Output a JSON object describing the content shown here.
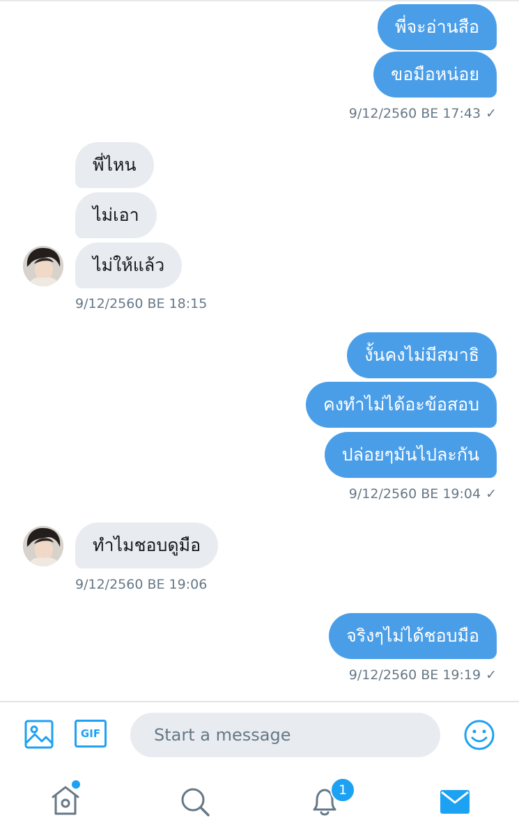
{
  "conversation": [
    {
      "type": "out",
      "text": "พี่จะอ่านสือ"
    },
    {
      "type": "out",
      "text": "ขอมือหน่อย"
    },
    {
      "type": "out_time",
      "text": "9/12/2560 BE 17:43"
    },
    {
      "type": "in",
      "text": "พี่ไหน"
    },
    {
      "type": "in",
      "text": "ไม่เอา"
    },
    {
      "type": "in",
      "text": "ไม่ให้แล้ว"
    },
    {
      "type": "in_time",
      "text": "9/12/2560 BE 18:15"
    },
    {
      "type": "out",
      "text": "งั้นคงไม่มีสมาธิ"
    },
    {
      "type": "out",
      "text": "คงทำไม่ได้อะข้อสอบ"
    },
    {
      "type": "out",
      "text": "ปล่อยๆมันไปละกัน"
    },
    {
      "type": "out_time",
      "text": "9/12/2560 BE 19:04"
    },
    {
      "type": "in",
      "text": "ทำไมชอบดูมือ"
    },
    {
      "type": "in_time",
      "text": "9/12/2560 BE 19:06"
    },
    {
      "type": "out",
      "text": "จริงๆไม่ได้ชอบมือ"
    },
    {
      "type": "out_time",
      "text": "9/12/2560 BE 19:19"
    }
  ],
  "read_mark": "✓",
  "composer": {
    "placeholder": "Start a message",
    "gif_label": "GIF",
    "image_icon": "image-icon",
    "emoji_icon": "emoji-icon"
  },
  "tabbar": {
    "home_icon": "home-icon",
    "search_icon": "search-icon",
    "notifications_icon": "bell-icon",
    "notifications_badge": "1",
    "messages_icon": "mail-icon"
  },
  "colors": {
    "outgoing_bubble": "#4a9ee8",
    "incoming_bubble": "#e8ecf0",
    "accent": "#1da1f2",
    "meta_text": "#657786"
  }
}
